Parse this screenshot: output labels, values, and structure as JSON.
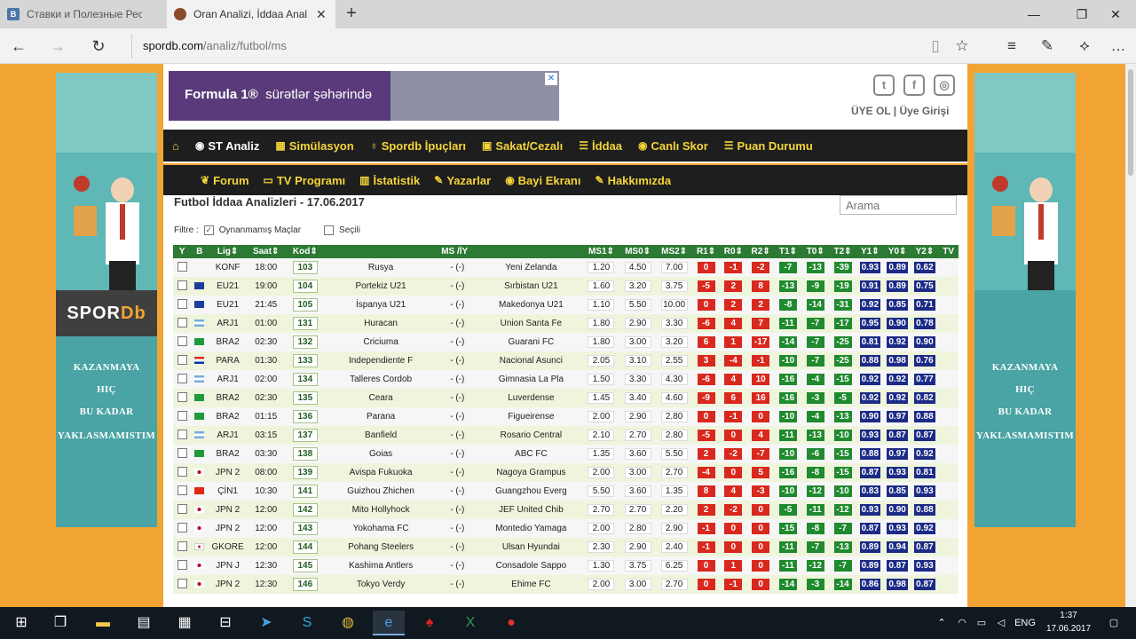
{
  "browser": {
    "tabs": [
      {
        "label": "Ставки и Полезные Ресурс",
        "icon": "vk-icon"
      },
      {
        "label": "Oran Analizi, İddaa Anal",
        "icon": "site-icon"
      }
    ],
    "url_host": "spordb.com",
    "url_path": "/analiz/futbol/ms"
  },
  "site": {
    "ad_text_bold": "Formula 1®",
    "ad_text_light": "sürətlər şəhərində",
    "auth": "ÜYE OL | Üye Girişi",
    "logo_a": "SPOR",
    "logo_b": "Db",
    "slogan": [
      "KAZANMAYA",
      "HIÇ",
      "BU KADAR",
      "YAKLASMAMISTIM"
    ],
    "nav1": [
      "ST Analiz",
      "Simülasyon",
      "Spordb İpuçları",
      "Sakat/Cezalı",
      "İddaa",
      "Canlı Skor",
      "Puan Durumu"
    ],
    "nav2": [
      "Forum",
      "TV Programı",
      "İstatistik",
      "Yazarlar",
      "Bayi Ekranı",
      "Hakkımızda"
    ],
    "page_title": "Futbol İddaa Analizleri - 17.06.2017",
    "search_placeholder": "Arama",
    "filter_label": "Filtre :",
    "filter_played": "Oynanmamış Maçlar",
    "filter_selected": "Seçili",
    "columns": [
      "Y",
      "B",
      "Lig⇕",
      "Saat⇕",
      "Kod⇕",
      "MS /İY",
      "MS1⇕",
      "MS0⇕",
      "MS2⇕",
      "R1⇕",
      "R0⇕",
      "R2⇕",
      "T1⇕",
      "T0⇕",
      "T2⇕",
      "Y1⇕",
      "Y0⇕",
      "Y2⇕",
      "TV"
    ],
    "rows": [
      {
        "flag": "none",
        "lig": "KONF",
        "saat": "18:00",
        "kod": "103",
        "home": "Rusya",
        "dash": "- (-)",
        "away": "Yeni Zelanda",
        "ms1": "1.20",
        "ms0": "4.50",
        "ms2": "7.00",
        "r1": "0",
        "r0": "-1",
        "r2": "-2",
        "t1": "-7",
        "t0": "-13",
        "t2": "-39",
        "y1": "0.93",
        "y0": "0.89",
        "y2": "0.62"
      },
      {
        "flag": "eu",
        "lig": "EU21",
        "saat": "19:00",
        "kod": "104",
        "home": "Portekiz U21",
        "dash": "- (-)",
        "away": "Sırbistan U21",
        "ms1": "1.60",
        "ms0": "3.20",
        "ms2": "3.75",
        "r1": "-5",
        "r0": "2",
        "r2": "8",
        "t1": "-13",
        "t0": "-9",
        "t2": "-19",
        "y1": "0.91",
        "y0": "0.89",
        "y2": "0.75"
      },
      {
        "flag": "eu",
        "lig": "EU21",
        "saat": "21:45",
        "kod": "105",
        "home": "İspanya U21",
        "dash": "- (-)",
        "away": "Makedonya U21",
        "ms1": "1.10",
        "ms0": "5.50",
        "ms2": "10.00",
        "r1": "0",
        "r0": "2",
        "r2": "2",
        "t1": "-8",
        "t0": "-14",
        "t2": "-31",
        "y1": "0.92",
        "y0": "0.85",
        "y2": "0.71"
      },
      {
        "flag": "ar",
        "lig": "ARJ1",
        "saat": "01:00",
        "kod": "131",
        "home": "Huracan",
        "dash": "- (-)",
        "away": "Union Santa Fe",
        "ms1": "1.80",
        "ms0": "2.90",
        "ms2": "3.30",
        "r1": "-6",
        "r0": "4",
        "r2": "7",
        "t1": "-11",
        "t0": "-7",
        "t2": "-17",
        "y1": "0.95",
        "y0": "0.90",
        "y2": "0.78"
      },
      {
        "flag": "br",
        "lig": "BRA2",
        "saat": "02:30",
        "kod": "132",
        "home": "Criciuma",
        "dash": "- (-)",
        "away": "Guarani FC",
        "ms1": "1.80",
        "ms0": "3.00",
        "ms2": "3.20",
        "r1": "6",
        "r0": "1",
        "r2": "-17",
        "t1": "-14",
        "t0": "-7",
        "t2": "-25",
        "y1": "0.81",
        "y0": "0.92",
        "y2": "0.90"
      },
      {
        "flag": "py",
        "lig": "PARA",
        "saat": "01:30",
        "kod": "133",
        "home": "Independiente F",
        "dash": "- (-)",
        "away": "Nacional Asunci",
        "ms1": "2.05",
        "ms0": "3.10",
        "ms2": "2.55",
        "r1": "3",
        "r0": "-4",
        "r2": "-1",
        "t1": "-10",
        "t0": "-7",
        "t2": "-25",
        "y1": "0.88",
        "y0": "0.98",
        "y2": "0.76"
      },
      {
        "flag": "ar",
        "lig": "ARJ1",
        "saat": "02:00",
        "kod": "134",
        "home": "Talleres Cordob",
        "dash": "- (-)",
        "away": "Gimnasia La Pla",
        "ms1": "1.50",
        "ms0": "3.30",
        "ms2": "4.30",
        "r1": "-6",
        "r0": "4",
        "r2": "10",
        "t1": "-16",
        "t0": "-4",
        "t2": "-15",
        "y1": "0.92",
        "y0": "0.92",
        "y2": "0.77"
      },
      {
        "flag": "br",
        "lig": "BRA2",
        "saat": "02:30",
        "kod": "135",
        "home": "Ceara",
        "dash": "- (-)",
        "away": "Luverdense",
        "ms1": "1.45",
        "ms0": "3.40",
        "ms2": "4.60",
        "r1": "-9",
        "r0": "6",
        "r2": "16",
        "t1": "-16",
        "t0": "-3",
        "t2": "-5",
        "y1": "0.92",
        "y0": "0.92",
        "y2": "0.82"
      },
      {
        "flag": "br",
        "lig": "BRA2",
        "saat": "01:15",
        "kod": "136",
        "home": "Parana",
        "dash": "- (-)",
        "away": "Figueirense",
        "ms1": "2.00",
        "ms0": "2.90",
        "ms2": "2.80",
        "r1": "0",
        "r0": "-1",
        "r2": "0",
        "t1": "-10",
        "t0": "-4",
        "t2": "-13",
        "y1": "0.90",
        "y0": "0.97",
        "y2": "0.88"
      },
      {
        "flag": "ar",
        "lig": "ARJ1",
        "saat": "03:15",
        "kod": "137",
        "home": "Banfield",
        "dash": "- (-)",
        "away": "Rosario Central",
        "ms1": "2.10",
        "ms0": "2.70",
        "ms2": "2.80",
        "r1": "-5",
        "r0": "0",
        "r2": "4",
        "t1": "-11",
        "t0": "-13",
        "t2": "-10",
        "y1": "0.93",
        "y0": "0.87",
        "y2": "0.87"
      },
      {
        "flag": "br",
        "lig": "BRA2",
        "saat": "03:30",
        "kod": "138",
        "home": "Goias",
        "dash": "- (-)",
        "away": "ABC FC",
        "ms1": "1.35",
        "ms0": "3.60",
        "ms2": "5.50",
        "r1": "2",
        "r0": "-2",
        "r2": "-7",
        "t1": "-10",
        "t0": "-6",
        "t2": "-15",
        "y1": "0.88",
        "y0": "0.97",
        "y2": "0.92"
      },
      {
        "flag": "jp",
        "lig": "JPN 2",
        "saat": "08:00",
        "kod": "139",
        "home": "Avispa Fukuoka",
        "dash": "- (-)",
        "away": "Nagoya Grampus",
        "ms1": "2.00",
        "ms0": "3.00",
        "ms2": "2.70",
        "r1": "-4",
        "r0": "0",
        "r2": "5",
        "t1": "-16",
        "t0": "-8",
        "t2": "-15",
        "y1": "0.87",
        "y0": "0.93",
        "y2": "0.81"
      },
      {
        "flag": "cn",
        "lig": "ÇİN1",
        "saat": "10:30",
        "kod": "141",
        "home": "Guizhou Zhichen",
        "dash": "- (-)",
        "away": "Guangzhou Everg",
        "ms1": "5.50",
        "ms0": "3.60",
        "ms2": "1.35",
        "r1": "8",
        "r0": "4",
        "r2": "-3",
        "t1": "-10",
        "t0": "-12",
        "t2": "-10",
        "y1": "0.83",
        "y0": "0.85",
        "y2": "0.93"
      },
      {
        "flag": "jp",
        "lig": "JPN 2",
        "saat": "12:00",
        "kod": "142",
        "home": "Mito Hollyhock",
        "dash": "- (-)",
        "away": "JEF United Chib",
        "ms1": "2.70",
        "ms0": "2.70",
        "ms2": "2.20",
        "r1": "2",
        "r0": "-2",
        "r2": "0",
        "t1": "-5",
        "t0": "-11",
        "t2": "-12",
        "y1": "0.93",
        "y0": "0.90",
        "y2": "0.88"
      },
      {
        "flag": "jp",
        "lig": "JPN 2",
        "saat": "12:00",
        "kod": "143",
        "home": "Yokohama FC",
        "dash": "- (-)",
        "away": "Montedio Yamaga",
        "ms1": "2.00",
        "ms0": "2.80",
        "ms2": "2.90",
        "r1": "-1",
        "r0": "0",
        "r2": "0",
        "t1": "-15",
        "t0": "-8",
        "t2": "-7",
        "y1": "0.87",
        "y0": "0.93",
        "y2": "0.92"
      },
      {
        "flag": "kr",
        "lig": "GKORE",
        "saat": "12:00",
        "kod": "144",
        "home": "Pohang Steelers",
        "dash": "- (-)",
        "away": "Ulsan Hyundai",
        "ms1": "2.30",
        "ms0": "2.90",
        "ms2": "2.40",
        "r1": "-1",
        "r0": "0",
        "r2": "0",
        "t1": "-11",
        "t0": "-7",
        "t2": "-13",
        "y1": "0.89",
        "y0": "0.94",
        "y2": "0.87"
      },
      {
        "flag": "jp",
        "lig": "JPN J",
        "saat": "12:30",
        "kod": "145",
        "home": "Kashima Antlers",
        "dash": "- (-)",
        "away": "Consadole Sappo",
        "ms1": "1.30",
        "ms0": "3.75",
        "ms2": "6.25",
        "r1": "0",
        "r0": "1",
        "r2": "0",
        "t1": "-11",
        "t0": "-12",
        "t2": "-7",
        "y1": "0.89",
        "y0": "0.87",
        "y2": "0.93"
      },
      {
        "flag": "jp",
        "lig": "JPN 2",
        "saat": "12:30",
        "kod": "146",
        "home": "Tokyo Verdy",
        "dash": "- (-)",
        "away": "Ehime FC",
        "ms1": "2.00",
        "ms0": "3.00",
        "ms2": "2.70",
        "r1": "0",
        "r0": "-1",
        "r2": "0",
        "t1": "-14",
        "t0": "-3",
        "t2": "-14",
        "y1": "0.86",
        "y0": "0.98",
        "y2": "0.87"
      }
    ]
  },
  "taskbar": {
    "lang": "ENG",
    "time": "1:37",
    "date": "17.06.2017"
  },
  "colors": {
    "page_orange": "#f1a433",
    "nav_bg": "#1e1e1e",
    "nav_text": "#f3d53a",
    "header_green": "#2c7a33",
    "red_badge": "#d9281e",
    "green_badge": "#1f8a2e",
    "blue_badge": "#1c2b86"
  }
}
